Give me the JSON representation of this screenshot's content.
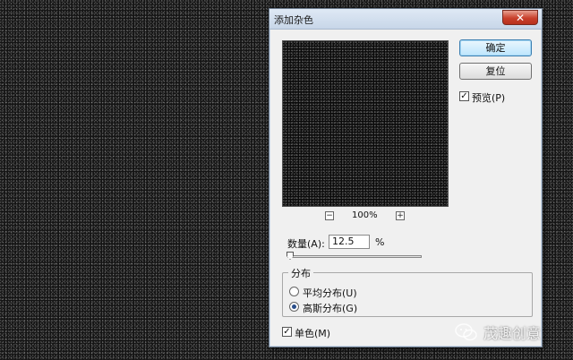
{
  "dialog": {
    "title": "添加杂色",
    "close_label": "✕",
    "zoom_level": "100%",
    "zoom_out_label": "−",
    "zoom_in_label": "+"
  },
  "buttons": {
    "ok_label": "确定",
    "reset_label": "复位"
  },
  "preview_toggle": {
    "label": "预览(P)",
    "checked": true
  },
  "amount": {
    "label": "数量(A):",
    "value": "12.5",
    "unit": "%",
    "slider_fraction": 0.0
  },
  "distribution": {
    "group_label": "分布",
    "options": [
      {
        "label": "平均分布(U)",
        "selected": false
      },
      {
        "label": "高斯分布(G)",
        "selected": true
      }
    ]
  },
  "monochrome": {
    "label": "单色(M)",
    "checked": true
  },
  "watermark": {
    "text": "茂趣创意"
  },
  "colors": {
    "ok_button": "#bde6fd",
    "close_button": "#c8402c",
    "canvas": "#141414"
  }
}
